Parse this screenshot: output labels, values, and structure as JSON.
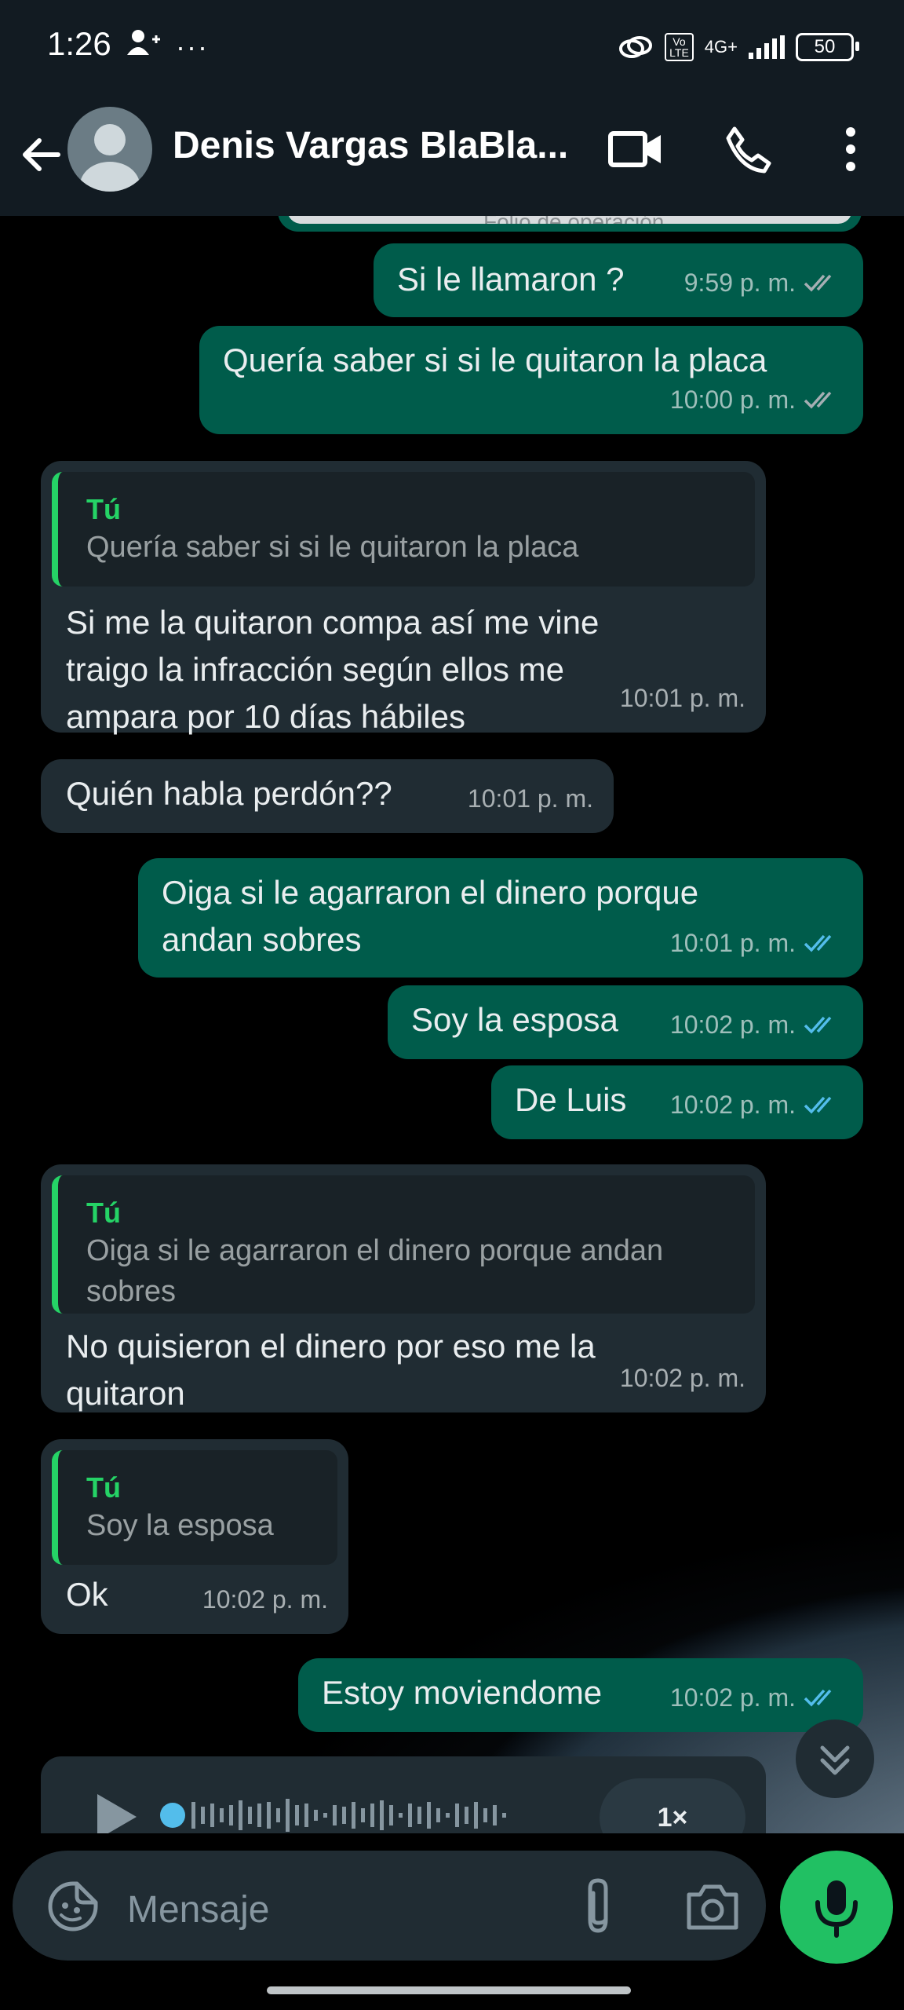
{
  "status_bar": {
    "time": "1:26",
    "battery": "50",
    "network": "4G+",
    "volte": "Vo LTE"
  },
  "header": {
    "contact_name": "Denis Vargas BlaBla..."
  },
  "partial_top_text": "Folio de operación",
  "messages": [
    {
      "dir": "out",
      "text": "Si le llamaron ?",
      "time": "9:59 p. m.",
      "read": false
    },
    {
      "dir": "out",
      "text": "Quería saber si si le quitaron la placa",
      "time": "10:00 p. m.",
      "read": false
    },
    {
      "dir": "in",
      "quote_author": "Tú",
      "quote_text": "Quería saber si si le quitaron la placa",
      "text": "Si me la quitaron compa así me vine\ntraigo la infracción según ellos me\nampara por 10 días hábiles",
      "time": "10:01 p. m."
    },
    {
      "dir": "in",
      "text": "Quién habla perdón??",
      "time": "10:01 p. m."
    },
    {
      "dir": "out",
      "text": "Oiga si le agarraron el dinero porque\nandan sobres",
      "time": "10:01 p. m.",
      "read": true
    },
    {
      "dir": "out",
      "text": "Soy la esposa",
      "time": "10:02 p. m.",
      "read": true
    },
    {
      "dir": "out",
      "text": "De Luis",
      "time": "10:02 p. m.",
      "read": true
    },
    {
      "dir": "in",
      "quote_author": "Tú",
      "quote_text": "Oiga si le agarraron el dinero porque andan\nsobres",
      "text": "No quisieron el dinero por eso me la\nquitaron",
      "time": "10:02 p. m."
    },
    {
      "dir": "in",
      "quote_author": "Tú",
      "quote_text": "Soy la esposa",
      "text": "Ok",
      "time": "10:02 p. m."
    },
    {
      "dir": "out",
      "text": "Estoy moviendome",
      "time": "10:02 p. m.",
      "read": true
    }
  ],
  "voice_note": {
    "speed": "1×",
    "progress": 0.0
  },
  "composer": {
    "placeholder": "Mensaje"
  },
  "colors": {
    "outgoing": "#005c4b",
    "incoming": "#202c33",
    "read_ticks": "#53bdeb",
    "accent": "#21c063"
  }
}
